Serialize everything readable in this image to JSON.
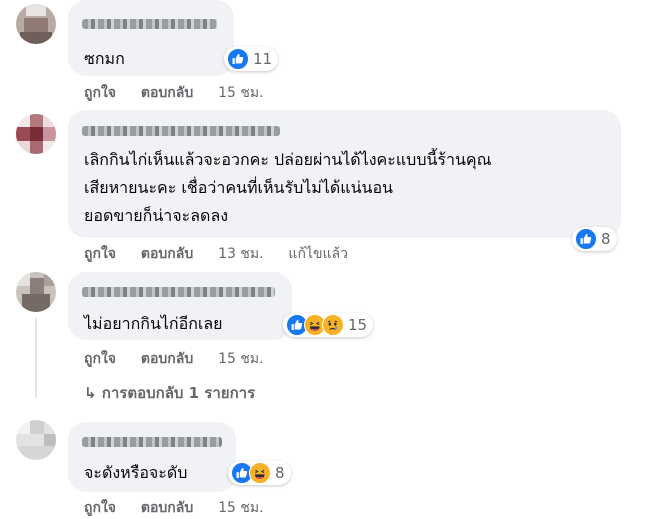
{
  "comments": [
    {
      "text_lines": [
        "ซกมก"
      ],
      "reaction_count": "11",
      "reactions": [
        "like-icon"
      ],
      "actions": {
        "like": "ถูกใจ",
        "reply": "ตอบกลับ",
        "time": "15 ชม."
      }
    },
    {
      "text_lines": [
        "เลิกกินไก่เห็นแล้วจะอวกคะ ปล่อยผ่านได้ไงคะแบบนี้ร้านคุณ",
        "เสียหายนะคะ เชื่อว่าคนที่เห็นรับไม่ได้แน่นอน",
        "ยอดขายก็น่าจะลดลง"
      ],
      "reaction_count": "8",
      "reactions": [
        "like-icon"
      ],
      "actions": {
        "like": "ถูกใจ",
        "reply": "ตอบกลับ",
        "time": "13 ชม.",
        "edited": "แก้ไขแล้ว"
      }
    },
    {
      "text_lines": [
        "ไม่อยากกินไก่อีกเลย"
      ],
      "reaction_count": "15",
      "reactions": [
        "like-icon",
        "haha-icon",
        "sad-icon"
      ],
      "actions": {
        "like": "ถูกใจ",
        "reply": "ตอบกลับ",
        "time": "15 ชม."
      },
      "replies_link": "↳ การตอบกลับ 1 รายการ"
    },
    {
      "text_lines": [
        "จะดังหรือจะดับ"
      ],
      "reaction_count": "8",
      "reactions": [
        "like-icon",
        "haha-icon"
      ],
      "actions": {
        "like": "ถูกใจ",
        "reply": "ตอบกลับ",
        "time": "15 ชม."
      }
    }
  ],
  "colors": {
    "bubble": "#f0f2f5",
    "like": "#1877f2",
    "secondary_text": "#65676b"
  }
}
